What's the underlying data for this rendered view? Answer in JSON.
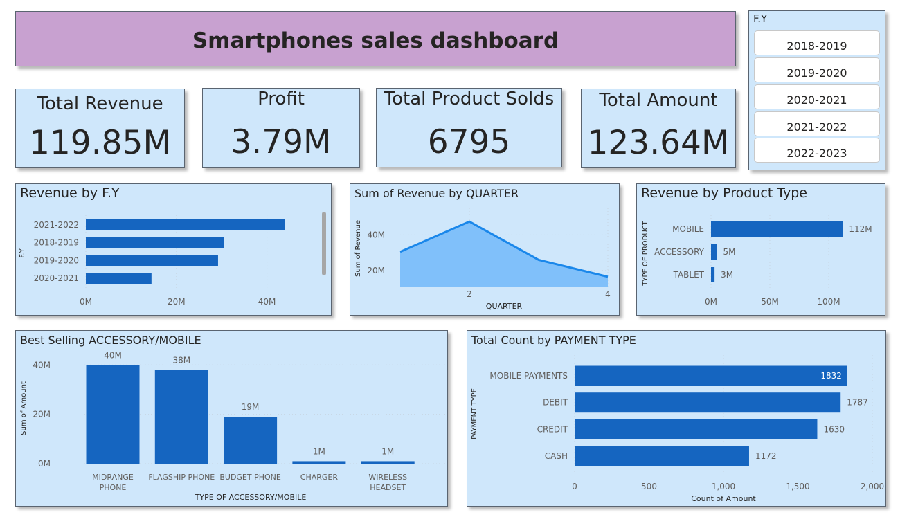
{
  "title": "Smartphones sales dashboard",
  "kpis": {
    "revenue": {
      "label": "Total Revenue",
      "value": "119.85M"
    },
    "profit": {
      "label": "Profit",
      "value": "3.79M"
    },
    "products": {
      "label": "Total Product Solds",
      "value": "6795"
    },
    "amount": {
      "label": "Total Amount",
      "value": "123.64M"
    }
  },
  "slicer": {
    "title": "F.Y",
    "items": [
      "2018-2019",
      "2019-2020",
      "2020-2021",
      "2021-2022",
      "2022-2023"
    ]
  },
  "colors": {
    "bar": "#1565c0",
    "area_fill": "#80c0fa",
    "area_line": "#1a87ea",
    "card_bg": "#cfe7fb",
    "banner_bg": "#c8a1d0"
  },
  "visuals": {
    "rev_fy": {
      "title": "Revenue by F.Y"
    },
    "rev_q": {
      "title": "Sum of Revenue by QUARTER"
    },
    "rev_type": {
      "title": "Revenue by Product Type"
    },
    "best": {
      "title": "Best Selling ACCESSORY/MOBILE"
    },
    "payment": {
      "title": "Total Count by PAYMENT TYPE"
    }
  },
  "chart_data": [
    {
      "id": "rev_fy",
      "type": "bar",
      "orientation": "horizontal",
      "title": "Revenue by F.Y",
      "ylabel": "F.Y",
      "categories": [
        "2021-2022",
        "2018-2019",
        "2019-2020",
        "2020-2021"
      ],
      "values": [
        44,
        30.5,
        29.2,
        14.5
      ],
      "xlim": [
        0,
        50
      ],
      "xticks": [
        0,
        20,
        40
      ],
      "xtick_labels": [
        "0M",
        "20M",
        "40M"
      ],
      "grid": true
    },
    {
      "id": "rev_q",
      "type": "area",
      "title": "Sum of Revenue by QUARTER",
      "xlabel": "QUARTER",
      "ylabel": "Sum of Revenue",
      "x": [
        1,
        2,
        3,
        4
      ],
      "values": [
        30.5,
        47.5,
        26,
        16.5
      ],
      "ylim": [
        11,
        53
      ],
      "yticks": [
        20,
        40
      ],
      "ytick_labels": [
        "20M",
        "40M"
      ],
      "xticks": [
        2,
        4
      ],
      "grid": true
    },
    {
      "id": "rev_type",
      "type": "bar",
      "orientation": "horizontal",
      "title": "Revenue by Product Type",
      "ylabel": "TYPE OF PRODUCT",
      "categories": [
        "MOBILE",
        "ACCESSORY",
        "TABLET"
      ],
      "values": [
        112,
        5,
        3
      ],
      "data_labels": [
        "112M",
        "5M",
        "3M"
      ],
      "xlim": [
        0,
        140
      ],
      "xticks": [
        0,
        50,
        100
      ],
      "xtick_labels": [
        "0M",
        "50M",
        "100M"
      ],
      "grid": true
    },
    {
      "id": "best",
      "type": "bar",
      "orientation": "vertical",
      "title": "Best Selling ACCESSORY/MOBILE",
      "xlabel": "TYPE OF ACCESSORY/MOBILE",
      "ylabel": "Sum of Amount",
      "categories": [
        [
          "MIDRANGE",
          "PHONE"
        ],
        [
          "FLAGSHIP PHONE"
        ],
        [
          "BUDGET PHONE"
        ],
        [
          "CHARGER"
        ],
        [
          "WIRELESS",
          "HEADSET"
        ]
      ],
      "values": [
        40,
        38,
        19,
        1,
        1
      ],
      "data_labels": [
        "40M",
        "38M",
        "19M",
        "1M",
        "1M"
      ],
      "ylim": [
        0,
        44
      ],
      "yticks": [
        0,
        20,
        40
      ],
      "ytick_labels": [
        "0M",
        "20M",
        "40M"
      ],
      "grid": true
    },
    {
      "id": "payment",
      "type": "bar",
      "orientation": "horizontal",
      "title": "Total Count by PAYMENT TYPE",
      "xlabel": "Count of Amount",
      "ylabel": "PAYMENT TYPE",
      "categories": [
        "MOBILE PAYMENTS",
        "DEBIT",
        "CREDIT",
        "CASH"
      ],
      "values": [
        1832,
        1787,
        1630,
        1172
      ],
      "data_labels": [
        "1832",
        "1787",
        "1630",
        "1172"
      ],
      "xlim": [
        0,
        2000
      ],
      "xticks": [
        0,
        500,
        1000,
        1500,
        2000
      ],
      "xtick_labels": [
        "0",
        "500",
        "1,000",
        "1,500",
        "2,000"
      ],
      "grid": true
    }
  ]
}
